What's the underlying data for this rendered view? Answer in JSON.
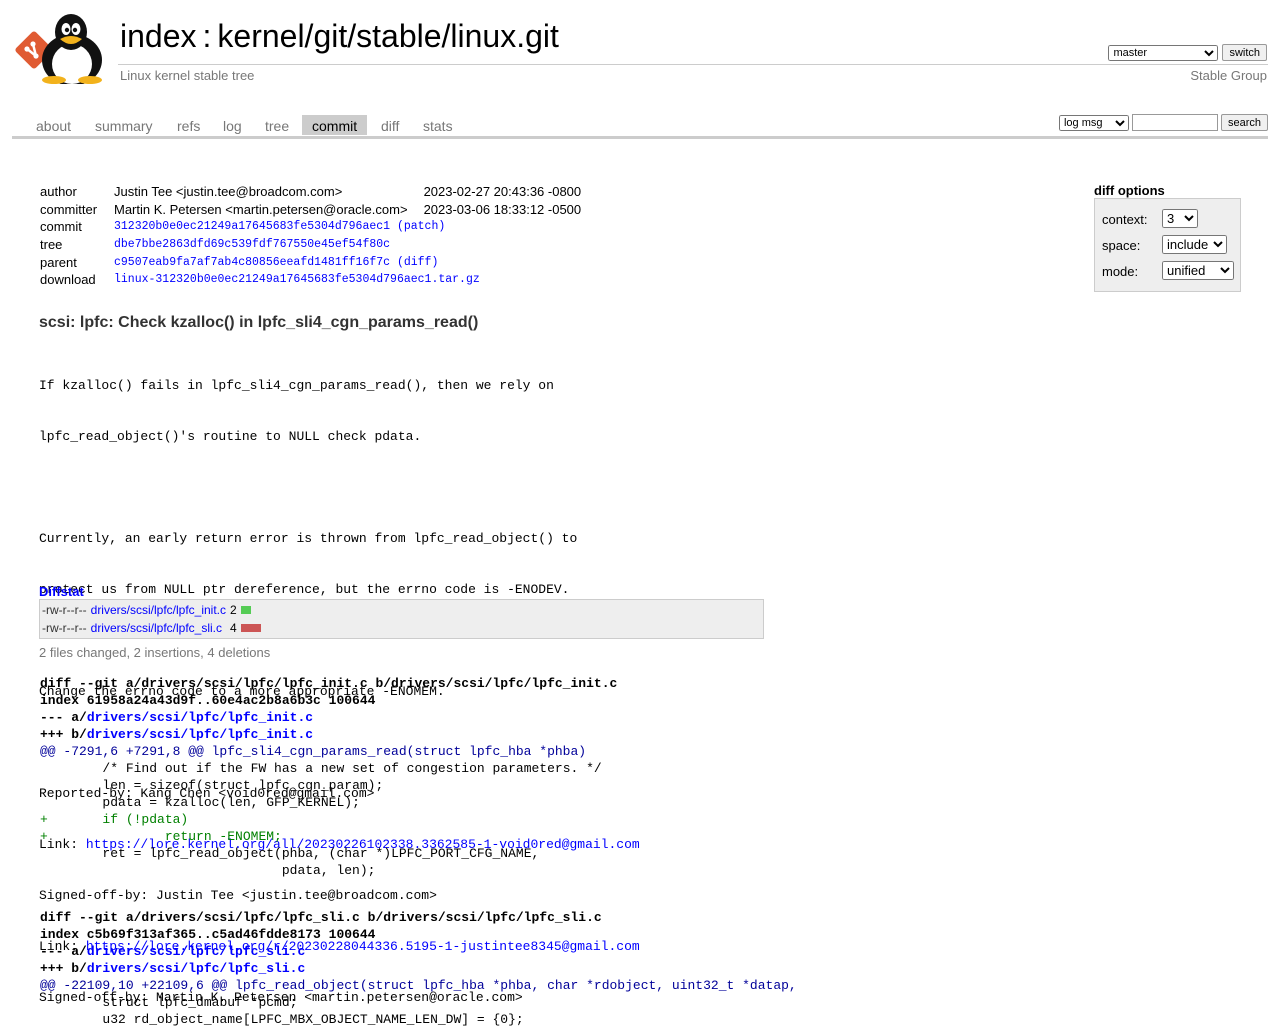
{
  "header": {
    "index_label": "index",
    "separator": ":",
    "repo_path": "kernel/git/stable/linux.git",
    "description": "Linux kernel stable tree",
    "owner": "Stable Group",
    "branch_selected": "master",
    "switch_label": "switch"
  },
  "tabs": {
    "about": "about",
    "summary": "summary",
    "refs": "refs",
    "log": "log",
    "tree": "tree",
    "commit": "commit",
    "diff": "diff",
    "stats": "stats"
  },
  "search": {
    "mode_selected": "log msg",
    "input_value": "",
    "button_label": "search"
  },
  "commit_info": {
    "author_label": "author",
    "author": "Justin Tee <justin.tee@broadcom.com>",
    "author_date": "2023-02-27 20:43:36 -0800",
    "committer_label": "committer",
    "committer": "Martin K. Petersen <martin.petersen@oracle.com>",
    "committer_date": "2023-03-06 18:33:12 -0500",
    "commit_label": "commit",
    "commit_hash": "312320b0e0ec21249a17645683fe5304d796aec1",
    "patch_label": "(patch)",
    "tree_label": "tree",
    "tree_hash": "dbe7bbe2863dfd69c539fdf767550e45ef54f80c",
    "parent_label": "parent",
    "parent_hash": "c9507eab9fa7af7ab4c80856eeafd1481ff16f7c",
    "diff_label": "(diff)",
    "download_label": "download",
    "download_file": "linux-312320b0e0ec21249a17645683fe5304d796aec1.tar.gz"
  },
  "diff_options": {
    "title": "diff options",
    "context_label": "context:",
    "context_value": "3",
    "space_label": "space:",
    "space_value": "include",
    "mode_label": "mode:",
    "mode_value": "unified"
  },
  "commit_message": {
    "subject": "scsi: lpfc: Check kzalloc() in lpfc_sli4_cgn_params_read()",
    "lines": [
      "If kzalloc() fails in lpfc_sli4_cgn_params_read(), then we rely on",
      "lpfc_read_object()'s routine to NULL check pdata.",
      "",
      "Currently, an early return error is thrown from lpfc_read_object() to",
      "protect us from NULL ptr dereference, but the errno code is -ENODEV.",
      "",
      "Change the errno code to a more appropriate -ENOMEM.",
      "",
      "Reported-by: Kang Chen <void0red@gmail.com>"
    ],
    "link1_prefix": "Link: ",
    "link1_url": "https://lore.kernel.org/all/20230226102338.3362585-1-void0red@gmail.com",
    "signoff1": "Signed-off-by: Justin Tee <justin.tee@broadcom.com>",
    "link2_prefix": "Link: ",
    "link2_url": "https://lore.kernel.org/r/20230228044336.5195-1-justintee8345@gmail.com",
    "signoff2": "Signed-off-by: Martin K. Petersen <martin.petersen@oracle.com>"
  },
  "diffstat": {
    "header": "Diffstat",
    "files": [
      {
        "mode": "-rw-r--r--",
        "path": "drivers/scsi/lpfc/lpfc_init.c",
        "count": "2",
        "bar_color": "#5c5"
      },
      {
        "mode": "-rw-r--r--",
        "path": "drivers/scsi/lpfc/lpfc_sli.c",
        "count": "4",
        "bar_color": "#c55"
      }
    ],
    "summary": "2 files changed, 2 insertions, 4 deletions"
  },
  "diffs": [
    {
      "header": "diff --git a/drivers/scsi/lpfc/lpfc_init.c b/drivers/scsi/lpfc/lpfc_init.c",
      "index": "index 61958a24a43d9f..60e4ac2b8a6b3c 100644",
      "minus_prefix": "--- a/",
      "plus_prefix": "+++ b/",
      "file": "drivers/scsi/lpfc/lpfc_init.c",
      "hunk": "@@ -7291,6 +7291,8 @@",
      "hunk_func": " lpfc_sli4_cgn_params_read(struct lpfc_hba *phba)",
      "lines": [
        {
          "t": "ctx",
          "s": " \t/* Find out if the FW has a new set of congestion parameters. */"
        },
        {
          "t": "ctx",
          "s": " \tlen = sizeof(struct lpfc_cgn_param);"
        },
        {
          "t": "ctx",
          "s": " \tpdata = kzalloc(len, GFP_KERNEL);"
        },
        {
          "t": "add",
          "s": "+\tif (!pdata)"
        },
        {
          "t": "add",
          "s": "+\t\treturn -ENOMEM;"
        },
        {
          "t": "ctx",
          "s": " \tret = lpfc_read_object(phba, (char *)LPFC_PORT_CFG_NAME,"
        },
        {
          "t": "ctx",
          "s": " \t\t\t       pdata, len);"
        }
      ]
    },
    {
      "header": "diff --git a/drivers/scsi/lpfc/lpfc_sli.c b/drivers/scsi/lpfc/lpfc_sli.c",
      "index": "index c5b69f313af365..c5ad46fdde8173 100644",
      "minus_prefix": "--- a/",
      "plus_prefix": "+++ b/",
      "file": "drivers/scsi/lpfc/lpfc_sli.c",
      "hunk": "@@ -22109,10 +22109,6 @@",
      "hunk_func": " lpfc_read_object(struct lpfc_hba *phba, char *rdobject, uint32_t *datap,",
      "lines": [
        {
          "t": "ctx",
          "s": " \tstruct lpfc_dmabuf *pcmd;"
        },
        {
          "t": "ctx",
          "s": " \tu32 rd_object_name[LPFC_MBX_OBJECT_NAME_LEN_DW] = {0};"
        }
      ]
    }
  ]
}
